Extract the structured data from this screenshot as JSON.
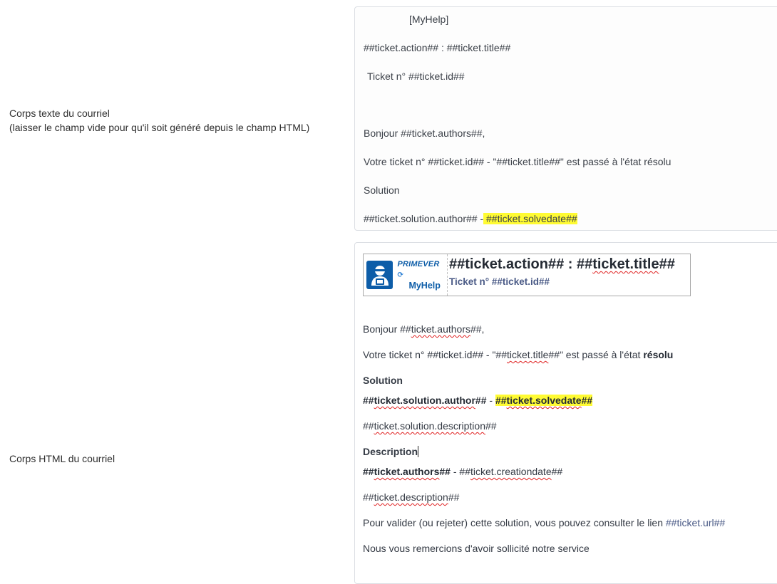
{
  "labels": {
    "text_body_line1": "Corps texte du courriel",
    "text_body_line2": "(laisser le champ vide pour qu'il soit généré depuis le champ HTML)",
    "html_body": "Corps HTML du courriel"
  },
  "text_body": {
    "myhelp": "[MyHelp]",
    "action_title": "##ticket.action## : ##ticket.title##",
    "ticket_number": "Ticket n° ##ticket.id##",
    "greeting": "Bonjour ##ticket.authors##,",
    "status": "Votre ticket n° ##ticket.id## - \"##ticket.title##\" est passé à l'état résolu",
    "solution": "Solution",
    "solution_author": "##ticket.solution.author## -",
    "solvedate": " ##ticket.solvedate## "
  },
  "html_body": {
    "logo": {
      "brand": "PRIMEVER",
      "product": "MyHelp"
    },
    "title_part1": "##ticket.action## : ##",
    "title_word": "ticket.title",
    "title_part2": "##",
    "subtitle": "Ticket n° ##ticket.id##",
    "greeting_a": "Bonjour ##",
    "greeting_word": "ticket.authors",
    "greeting_b": "##,",
    "status_a": "Votre ticket n° ##ticket.id## - \"##",
    "status_word": "ticket.title",
    "status_b": "##\" est passé à l'état ",
    "status_bold": "résolu",
    "solution_heading": "Solution",
    "sol_author_a": "##",
    "sol_author_word": "ticket.solution.author",
    "sol_author_b": "##",
    "sol_sep": " - ",
    "solvedate_a": "##",
    "solvedate_word": "ticket.solvedate",
    "solvedate_b": "##",
    "sol_desc_a": "##",
    "sol_desc_word": "ticket.solution.description",
    "sol_desc_b": "##",
    "description_heading": "Description",
    "authors_a": "##",
    "authors_word": "ticket.authors",
    "authors_b": "##",
    "creation_sep": " - ##",
    "creation_word": "ticket.creationdate",
    "creation_b": "##",
    "desc_a": "##",
    "desc_word": "ticket.description",
    "desc_b": "##",
    "validate_text": "Pour valider (ou rejeter) cette solution, vous pouvez consulter le lien ",
    "validate_link": "##ticket.url##",
    "thanks": "Nous vous remercions d'avoir sollicité notre service"
  },
  "colors": {
    "highlight": "#fffb33",
    "brand_blue": "#0d5da8",
    "link": "#4a5a86"
  }
}
